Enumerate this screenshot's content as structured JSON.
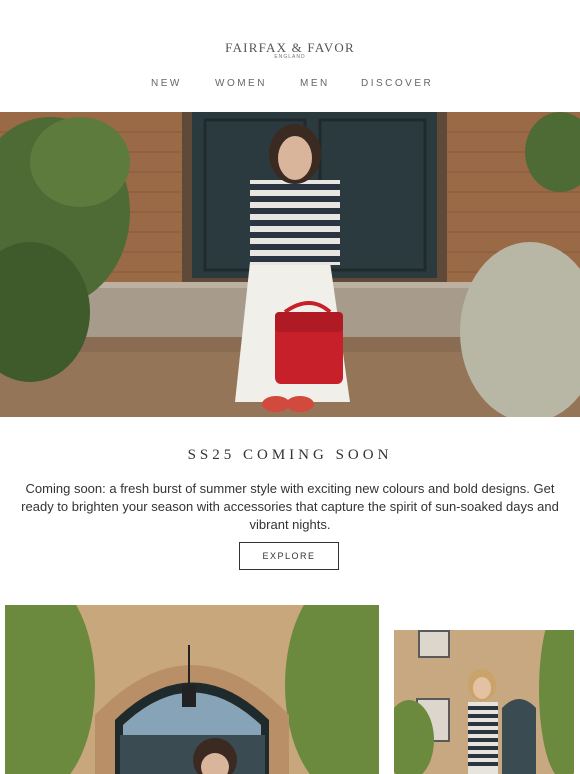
{
  "brand": {
    "name": "FAIRFAX & FAVOR",
    "subtitle": "ENGLAND"
  },
  "nav": {
    "items": [
      "NEW",
      "WOMEN",
      "MEN",
      "DISCOVER"
    ]
  },
  "hero": {
    "image_label": "hero-photo"
  },
  "promo": {
    "headline": "SS25 COMING SOON",
    "body": "Coming soon: a fresh burst of summer style with exciting new colours and bold designs. Get ready to brighten your season with accessories that capture the spirit of sun-soaked days and vibrant nights.",
    "cta_label": "EXPLORE"
  },
  "colors": {
    "accent": "#333333",
    "door": "#2b3a3e",
    "brick": "#a66f47",
    "bag": "#c8202a"
  }
}
